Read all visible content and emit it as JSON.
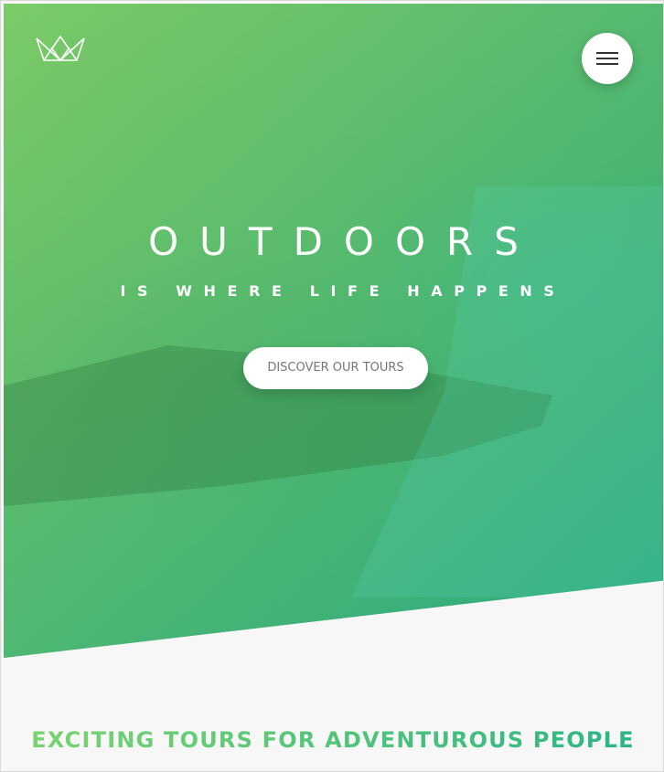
{
  "header": {
    "logo_icon": "crown-logo-icon",
    "menu_icon": "hamburger-menu-icon"
  },
  "hero": {
    "title": "OUTDOORS",
    "subtitle": "IS WHERE LIFE HAPPENS",
    "cta_label": "DISCOVER OUR TOURS",
    "gradient_start": "#7ed56f",
    "gradient_end": "#28b485"
  },
  "about": {
    "heading": "EXCITING TOURS FOR ADVENTUROUS PEOPLE"
  }
}
